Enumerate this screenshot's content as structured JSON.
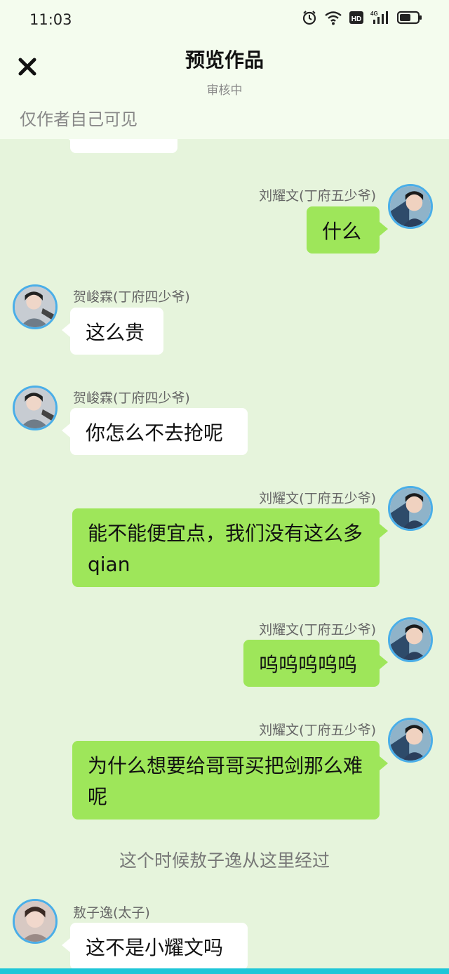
{
  "status_bar": {
    "time": "11:03",
    "icons": [
      "alarm-icon",
      "wifi-icon",
      "hd-icon",
      "signal-4g-icon",
      "battery-icon"
    ],
    "hd_label": "HD",
    "network_label": "4G"
  },
  "header": {
    "title": "预览作品",
    "subtitle": "审核中",
    "visibility_note": "仅作者自己可见"
  },
  "colors": {
    "background": "#e6f4dc",
    "header_bg": "#f4fcee",
    "own_bubble": "#9ee65a",
    "other_bubble": "#ffffff",
    "avatar_border": "#4aaee8"
  },
  "messages": [
    {
      "side": "right",
      "sender": "刘耀文(丁府五少爷)",
      "text": "什么"
    },
    {
      "side": "left",
      "sender": "贺峻霖(丁府四少爷)",
      "text": "这么贵"
    },
    {
      "side": "left",
      "sender": "贺峻霖(丁府四少爷)",
      "text": "你怎么不去抢呢"
    },
    {
      "side": "right",
      "sender": "刘耀文(丁府五少爷)",
      "text": "能不能便宜点，我们没有这么多qian"
    },
    {
      "side": "right",
      "sender": "刘耀文(丁府五少爷)",
      "text": "呜呜呜呜呜"
    },
    {
      "side": "right",
      "sender": "刘耀文(丁府五少爷)",
      "text": "为什么想要给哥哥买把剑那么难呢"
    },
    {
      "side": "left",
      "sender": "敖子逸(太子)",
      "text": "这不是小耀文吗"
    }
  ],
  "narration": "这个时候敖子逸从这里经过"
}
